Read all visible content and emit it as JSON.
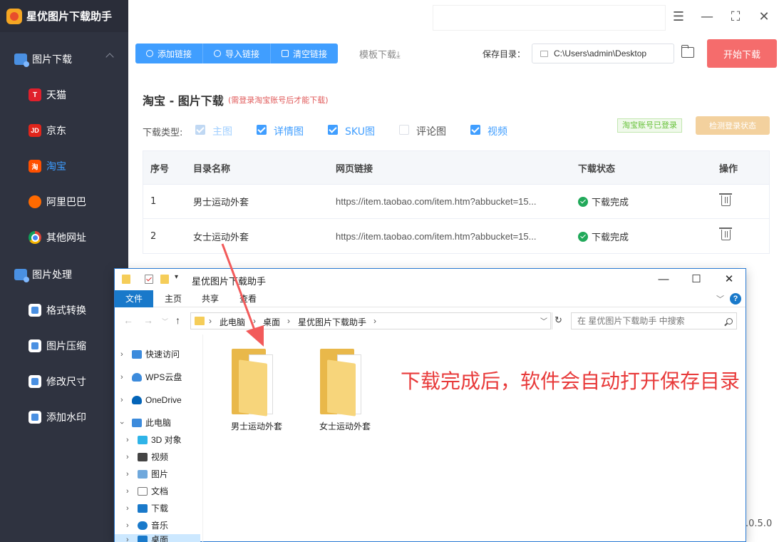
{
  "app": {
    "title": "星优图片下载助手",
    "version": ".0.5.0"
  },
  "sidebar": {
    "group1": {
      "label": "图片下载"
    },
    "items1": [
      {
        "label": "天猫",
        "icon": "T"
      },
      {
        "label": "京东",
        "icon": "JD"
      },
      {
        "label": "淘宝",
        "icon": "淘"
      },
      {
        "label": "阿里巴巴",
        "icon": ""
      },
      {
        "label": "其他网址",
        "icon": ""
      }
    ],
    "group2": {
      "label": "图片处理"
    },
    "items2": [
      {
        "label": "格式转换"
      },
      {
        "label": "图片压缩"
      },
      {
        "label": "修改尺寸"
      },
      {
        "label": "添加水印"
      }
    ]
  },
  "toolbar": {
    "add_link": "添加链接",
    "import_link": "导入链接",
    "clear_link": "清空链接",
    "template_download": "模板下载⤓",
    "save_dir_label": "保存目录：",
    "save_dir_value": "C:\\Users\\admin\\Desktop",
    "start_download": "开始下载"
  },
  "content": {
    "title": "淘宝 - 图片下载",
    "note": "(需登录淘宝账号后才能下载)",
    "type_label": "下载类型:",
    "types": [
      {
        "label": "主图"
      },
      {
        "label": "详情图"
      },
      {
        "label": "SKU图"
      },
      {
        "label": "评论图"
      },
      {
        "label": "视频"
      }
    ],
    "login_badge": "淘宝账号已登录",
    "check_login": "检测登录状态"
  },
  "table": {
    "headers": [
      "序号",
      "目录名称",
      "网页链接",
      "下载状态",
      "操作"
    ],
    "rows": [
      {
        "index": "1",
        "name": "男士运动外套",
        "url": "https://item.taobao.com/item.htm?abbucket=15...",
        "status": "下载完成"
      },
      {
        "index": "2",
        "name": "女士运动外套",
        "url": "https://item.taobao.com/item.htm?abbucket=15...",
        "status": "下载完成"
      }
    ]
  },
  "explorer": {
    "title": "星优图片下载助手",
    "tabs": [
      "文件",
      "主页",
      "共享",
      "查看"
    ],
    "breadcrumb": [
      "此电脑",
      "桌面",
      "星优图片下载助手"
    ],
    "search_placeholder": "在 星优图片下载助手 中搜索",
    "nav": [
      "快速访问",
      "WPS云盘",
      "OneDrive",
      "此电脑",
      "3D 对象",
      "视频",
      "图片",
      "文档",
      "下载",
      "音乐",
      "桌面"
    ],
    "folders": [
      "男士运动外套",
      "女士运动外套"
    ]
  },
  "annotation": "下载完成后，软件会自动打开保存目录",
  "colors": {
    "sidebar_bg": "#2f3340",
    "primary": "#409eff",
    "danger": "#f56c6c",
    "success": "#21a95a",
    "annotation": "#e83a3a"
  }
}
